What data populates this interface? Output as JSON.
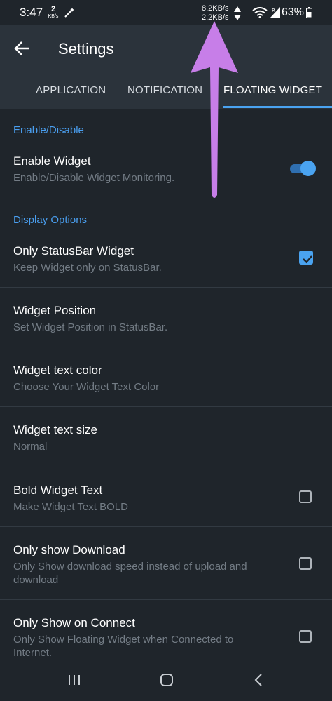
{
  "status_bar": {
    "time": "3:47",
    "data_rate_value": "2",
    "data_rate_unit": "KB/s",
    "upload_speed": "8.2KB/s",
    "download_speed": "2.2KB/s",
    "battery": "63%",
    "icons": [
      "magic-wand-icon",
      "wifi-icon",
      "signal-icon",
      "battery-icon"
    ]
  },
  "app_bar": {
    "title": "Settings",
    "back_icon": "arrow-left-icon"
  },
  "tabs": [
    {
      "label": "APPLICATION",
      "active": false
    },
    {
      "label": "NOTIFICATION",
      "active": false
    },
    {
      "label": "FLOATING WIDGET",
      "active": true
    }
  ],
  "sections": {
    "enable": {
      "header": "Enable/Disable"
    },
    "display": {
      "header": "Display Options"
    }
  },
  "items": {
    "enable_widget": {
      "title": "Enable Widget",
      "subtitle": "Enable/Disable Widget Monitoring.",
      "control": "toggle",
      "value": true
    },
    "only_statusbar": {
      "title": "Only StatusBar Widget",
      "subtitle": "Keep Widget only on StatusBar.",
      "control": "checkbox",
      "value": true
    },
    "widget_position": {
      "title": "Widget Position",
      "subtitle": "Set Widget Position in StatusBar."
    },
    "text_color": {
      "title": "Widget text color",
      "subtitle": "Choose Your Widget Text Color"
    },
    "text_size": {
      "title": "Widget text size",
      "subtitle": "Normal"
    },
    "bold_text": {
      "title": "Bold Widget Text",
      "subtitle": "Make Widget Text BOLD",
      "control": "checkbox",
      "value": false
    },
    "only_download": {
      "title": "Only show Download",
      "subtitle_line1": "Only Show download speed instead of upload and",
      "subtitle_line2": "download",
      "control": "checkbox",
      "value": false
    },
    "only_connect": {
      "title": "Only Show on Connect",
      "subtitle_line1": "Only Show Floating Widget when Connected to",
      "subtitle_line2": "Internet.",
      "control": "checkbox",
      "value": false
    }
  },
  "nav_bar": {
    "icons": [
      "recents-icon",
      "home-icon",
      "back-icon"
    ]
  },
  "colors": {
    "accent": "#4aa3f0",
    "background": "#1f252b",
    "app_bar": "#2b333b",
    "annotation_arrow": "#c77ee8"
  }
}
